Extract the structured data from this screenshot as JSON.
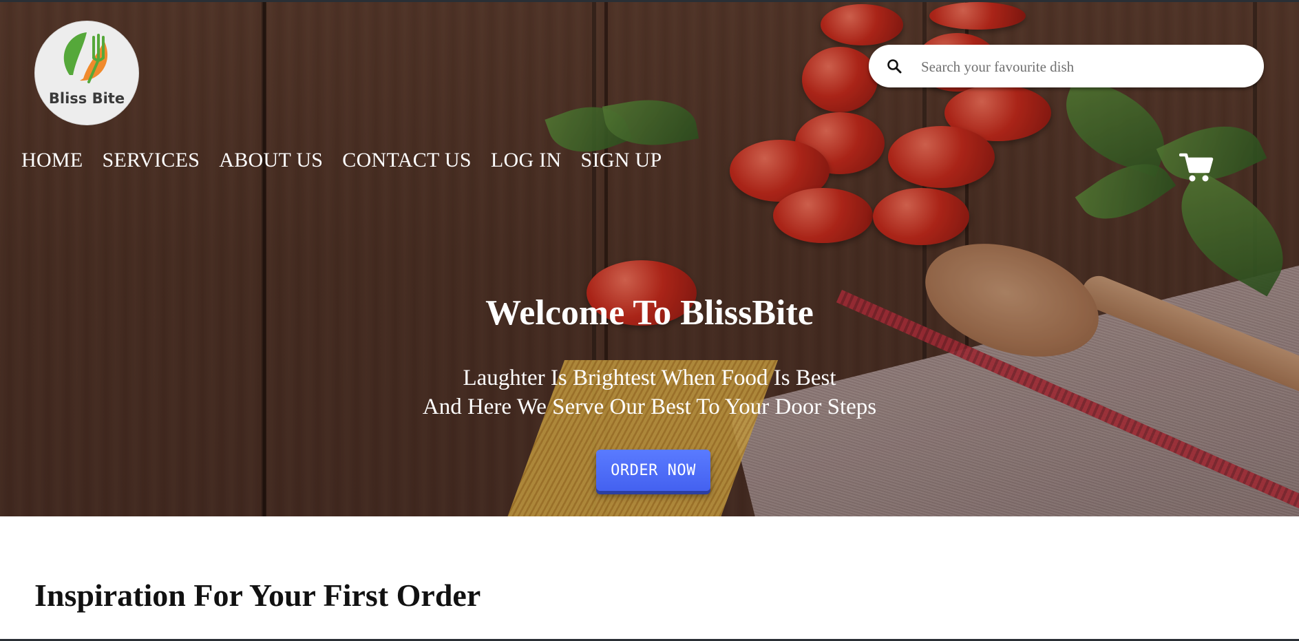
{
  "brand": {
    "logo_text": "Bliss Bite",
    "logo_colors": {
      "leaf": "#55a83a",
      "fork": "#f08a2c",
      "bg": "#ededed"
    }
  },
  "nav": {
    "items": [
      {
        "label": "HOME"
      },
      {
        "label": "SERVICES"
      },
      {
        "label": "ABOUT US"
      },
      {
        "label": "CONTACT US"
      },
      {
        "label": "LOG IN"
      },
      {
        "label": "SIGN UP"
      }
    ]
  },
  "search": {
    "placeholder": "Search your favourite dish",
    "value": "",
    "icon": "search-icon"
  },
  "cart": {
    "icon": "shopping-cart-icon"
  },
  "hero": {
    "title": "Welcome To BlissBite",
    "subtitle_line1": "Laughter Is Brightest When Food Is Best",
    "subtitle_line2": "And Here We Serve Our Best To Your Door Steps",
    "cta_label": "ORDER NOW",
    "cta_color": "#4d6cff"
  },
  "section": {
    "title": "Inspiration For Your First Order"
  }
}
